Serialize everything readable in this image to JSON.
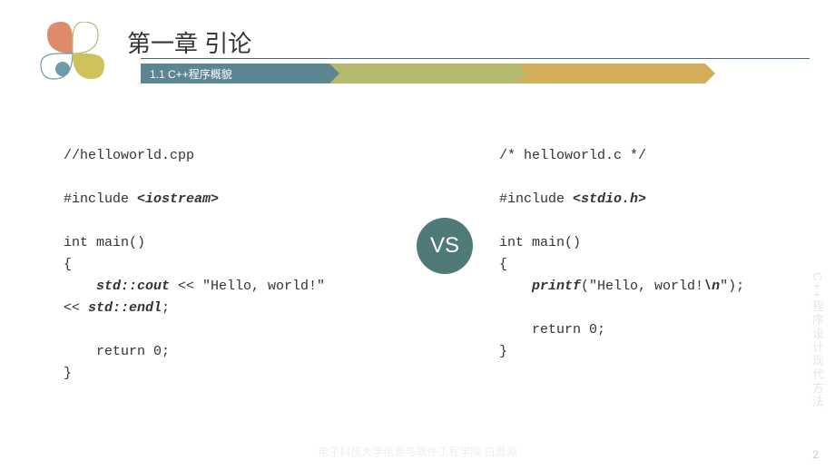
{
  "header": {
    "title": "第一章 引论",
    "subtitle": "1.1 C++程序概貌"
  },
  "code_left": {
    "comment": "//helloworld.cpp",
    "include_pre": "#include ",
    "include_lib": "<iostream>",
    "main_sig": "int main()",
    "brace_open": "{",
    "line_indent": "    ",
    "cout": "std::cout",
    "cout_mid": " << \"Hello, world!\"",
    "cout_op2": "<< ",
    "endl": "std::endl",
    "semi": ";",
    "return_line": "    return 0;",
    "brace_close": "}"
  },
  "vs_label": "VS",
  "code_right": {
    "comment": "/* helloworld.c */",
    "include_pre": "#include ",
    "include_lib": "<stdio.h>",
    "main_sig": "int main()",
    "brace_open": "{",
    "line_indent": "    ",
    "printf": "printf",
    "printf_arg_pre": "(\"Hello, world!",
    "newline": "\\n",
    "printf_arg_post": "\");",
    "return_line": "    return 0;",
    "brace_close": "}"
  },
  "side_text": "C++程序设计现代方法",
  "footer": "电子科技大学信息与软件工程学院 白思源",
  "page_num": "2"
}
